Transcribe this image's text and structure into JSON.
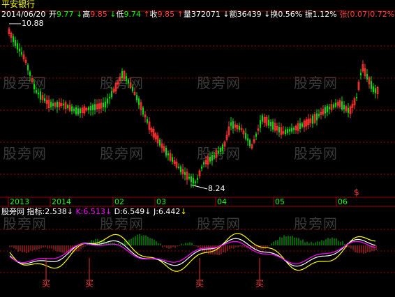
{
  "header": {
    "title": "平安银行",
    "date": "2014/06/20",
    "open_label": "开",
    "open_value": "9.77",
    "high_label": "高",
    "high_value": "9.85",
    "low_label": "低",
    "low_value": "9.74",
    "close_label": "收",
    "close_value": "9.85",
    "volume_label": "量",
    "volume_value": "372071",
    "amount_label": "额",
    "amount_value": "36439",
    "turnover_label": "换",
    "turnover_value": "0.56%",
    "amplitude_label": "振",
    "amplitude_value": "1.12%",
    "change_label": "张",
    "change_value": "(0.07)",
    "change_pct": "0.72%",
    "cutoff_label": "指",
    "up_arrow": "↑",
    "down_arrow": "↓"
  },
  "price_panel": {
    "high_marker": "10.88",
    "low_marker": "8.24",
    "special_marker": "$"
  },
  "x_axis": {
    "labels": [
      "2013",
      "2014",
      "02",
      "03",
      "04",
      "05",
      "06"
    ]
  },
  "indicator_panel": {
    "name": "股旁网",
    "label_text": "指标:",
    "value": "2.538",
    "k_label": "K:",
    "k_value": "6.513",
    "d_label": "D:",
    "d_value": "6.549",
    "j_label": "J:",
    "j_value": "6.442",
    "buy_label": "买"
  },
  "watermark_text": "股旁网",
  "colors": {
    "up": "#ff3232",
    "down": "#00e000",
    "grid_dotted": "#a00000",
    "k_line": "#ffffff",
    "d_line": "#ffff00",
    "j_line": "#ff00ff"
  },
  "chart_data": {
    "type": "candlestick",
    "title": "平安银行",
    "ylim": [
      8.24,
      10.88
    ],
    "x_labels": [
      "2013",
      "2014",
      "02",
      "03",
      "04",
      "05",
      "06"
    ],
    "annotations": [
      "10.88",
      "8.24",
      "买"
    ],
    "series": [
      {
        "name": "指标",
        "last": 2.538
      },
      {
        "name": "K",
        "last": 6.513
      },
      {
        "name": "D",
        "last": 6.549
      },
      {
        "name": "J",
        "last": 6.442
      }
    ]
  }
}
